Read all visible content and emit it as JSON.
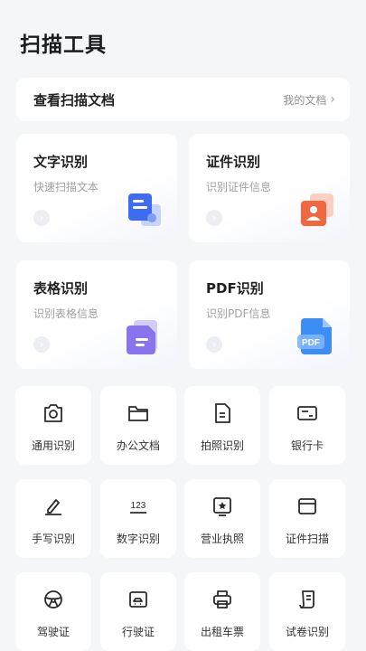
{
  "header": {
    "title": "扫描工具"
  },
  "doc_bar": {
    "title": "查看扫描文档",
    "link": "我的文档"
  },
  "cards": [
    {
      "title": "文字识别",
      "subtitle": "快速扫描文本"
    },
    {
      "title": "证件识别",
      "subtitle": "识别证件信息"
    },
    {
      "title": "表格识别",
      "subtitle": "识别表格信息"
    },
    {
      "title": "PDF识别",
      "subtitle": "识别PDF信息",
      "badge": "PDF"
    }
  ],
  "tools": [
    {
      "label": "通用识别",
      "icon": "camera-icon"
    },
    {
      "label": "办公文档",
      "icon": "folder-icon"
    },
    {
      "label": "拍照识别",
      "icon": "document-icon"
    },
    {
      "label": "银行卡",
      "icon": "bank-card-icon"
    },
    {
      "label": "手写识别",
      "icon": "pen-icon"
    },
    {
      "label": "数字识别",
      "icon": "number-icon",
      "glyph": "123"
    },
    {
      "label": "营业执照",
      "icon": "license-icon"
    },
    {
      "label": "证件扫描",
      "icon": "id-card-icon"
    },
    {
      "label": "驾驶证",
      "icon": "steering-wheel-icon"
    },
    {
      "label": "行驶证",
      "icon": "vehicle-license-icon"
    },
    {
      "label": "出租车票",
      "icon": "printer-icon"
    },
    {
      "label": "试卷识别",
      "icon": "exam-paper-icon"
    }
  ],
  "colors": {
    "page_bg": "#f4f6f8",
    "blue": "#3d6cf2",
    "orange": "#f0683f",
    "purple": "#8a74ee"
  }
}
